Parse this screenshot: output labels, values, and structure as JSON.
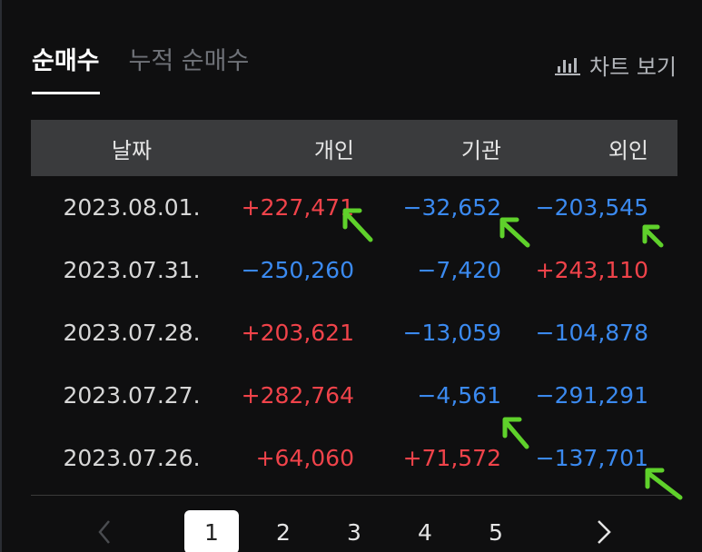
{
  "tabs": {
    "net_buy": "순매수",
    "cumulative_net_buy": "누적 순매수"
  },
  "chart_link": {
    "label": "차트 보기",
    "icon": "bar-chart-icon"
  },
  "table": {
    "headers": [
      "날짜",
      "개인",
      "기관",
      "외인"
    ],
    "rows": [
      {
        "date": "2023.08.01.",
        "individual": "+227,471",
        "institution": "−32,652",
        "foreign": "−203,545"
      },
      {
        "date": "2023.07.31.",
        "individual": "−250,260",
        "institution": "−7,420",
        "foreign": "+243,110"
      },
      {
        "date": "2023.07.28.",
        "individual": "+203,621",
        "institution": "−13,059",
        "foreign": "−104,878"
      },
      {
        "date": "2023.07.27.",
        "individual": "+282,764",
        "institution": "−4,561",
        "foreign": "−291,291"
      },
      {
        "date": "2023.07.26.",
        "individual": "+64,060",
        "institution": "+71,572",
        "foreign": "−137,701"
      }
    ]
  },
  "colors": {
    "positive": "#f0434a",
    "negative": "#3b8af0",
    "annotation": "#5fd12b"
  },
  "pagination": {
    "pages": [
      "1",
      "2",
      "3",
      "4",
      "5"
    ],
    "current": "1"
  }
}
